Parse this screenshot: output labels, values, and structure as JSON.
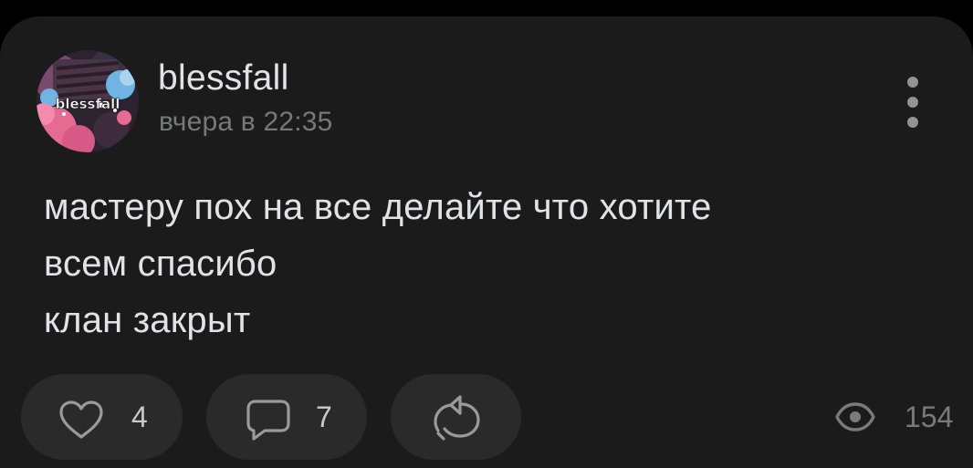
{
  "post": {
    "author": {
      "name": "blessfall",
      "avatar_text": "blessfall"
    },
    "timestamp": "вчера в 22:35",
    "text_lines": [
      "мастеру пох на все делайте что хотите",
      "всем спасибо",
      "клан закрыт"
    ],
    "actions": {
      "likes": "4",
      "comments": "7",
      "views": "154"
    }
  },
  "icons": {
    "menu": "more-vertical-icon",
    "like": "heart-icon",
    "comment": "comment-icon",
    "share": "share-icon",
    "views": "eye-icon"
  },
  "colors": {
    "background": "#000000",
    "card": "#1b1b1b",
    "pill": "#2a2a2a",
    "text_primary": "#e1e3e6",
    "text_secondary": "#76787a",
    "avatar_pink": "#e56b93",
    "avatar_blue": "#6fb4e3"
  }
}
